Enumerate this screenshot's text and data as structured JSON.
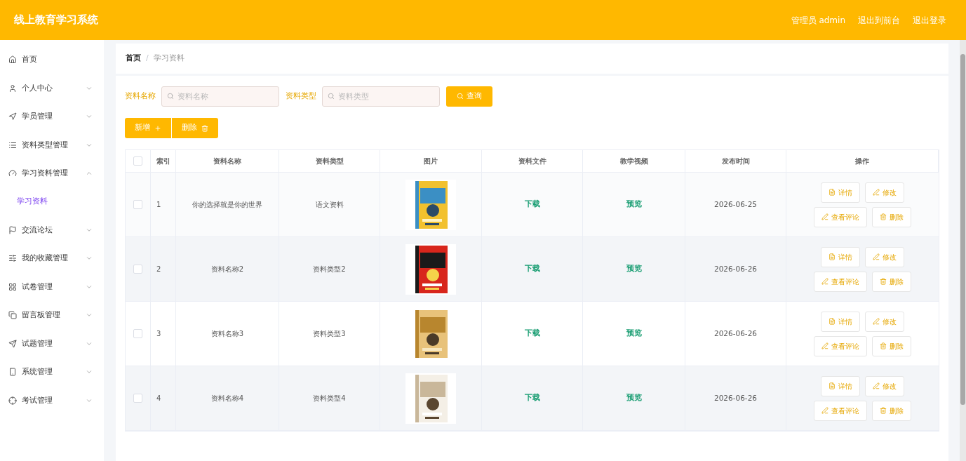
{
  "header": {
    "title": "线上教育学习系统",
    "links": [
      "管理员 admin",
      "退出到前台",
      "退出登录"
    ]
  },
  "sidebar": {
    "items": [
      {
        "label": "首页",
        "kind": "home"
      },
      {
        "label": "个人中心",
        "kind": "user",
        "expanded": false
      },
      {
        "label": "学员管理",
        "kind": "navigate",
        "expanded": false
      },
      {
        "label": "资料类型管理",
        "kind": "list",
        "expanded": false
      },
      {
        "label": "学习资料管理",
        "kind": "gauge",
        "expanded": true,
        "children": [
          {
            "label": "学习资料",
            "selected": true
          }
        ]
      },
      {
        "label": "交流论坛",
        "kind": "flag",
        "expanded": false
      },
      {
        "label": "我的收藏管理",
        "kind": "sliders",
        "expanded": false
      },
      {
        "label": "试卷管理",
        "kind": "grid",
        "expanded": false
      },
      {
        "label": "留言板管理",
        "kind": "copy",
        "expanded": false
      },
      {
        "label": "试题管理",
        "kind": "send",
        "expanded": false
      },
      {
        "label": "系统管理",
        "kind": "phone",
        "expanded": false
      },
      {
        "label": "考试管理",
        "kind": "target",
        "expanded": false
      }
    ]
  },
  "breadcrumb": {
    "separator": "/",
    "items": [
      "首页",
      "学习资料"
    ]
  },
  "search": {
    "fields": [
      {
        "label": "资料名称",
        "placeholder": "资料名称"
      },
      {
        "label": "资料类型",
        "placeholder": "资料类型"
      }
    ],
    "button": "查询"
  },
  "toolbar": [
    {
      "label": "新增",
      "kind": "add"
    },
    {
      "label": "删除",
      "kind": "delete"
    }
  ],
  "table": {
    "select_all": {
      "checked": false
    },
    "columns": [
      "索引",
      "资料名称",
      "资料类型",
      "图片",
      "资料文件",
      "教学视频",
      "发布时间",
      "操作"
    ],
    "rows": [
      {
        "checked": false,
        "index": "1",
        "name": "你的选择就是你的世界",
        "type": "语文资料",
        "file": "下载",
        "video": "预览",
        "date": "2026-06-25",
        "actions": [
          {
            "label": "详情",
            "kind": "detail"
          },
          {
            "label": "修改",
            "kind": "edit"
          },
          {
            "label": "查看评论",
            "kind": "comments"
          },
          {
            "label": "删除",
            "kind": "delete"
          }
        ]
      },
      {
        "checked": false,
        "index": "2",
        "name": "资料名称2",
        "type": "资料类型2",
        "file": "下载",
        "video": "预览",
        "date": "2026-06-26",
        "actions": [
          {
            "label": "详情",
            "kind": "detail"
          },
          {
            "label": "修改",
            "kind": "edit"
          },
          {
            "label": "查看评论",
            "kind": "comments"
          },
          {
            "label": "删除",
            "kind": "delete"
          }
        ]
      },
      {
        "checked": false,
        "index": "3",
        "name": "资料名称3",
        "type": "资料类型3",
        "file": "下载",
        "video": "预览",
        "date": "2026-06-26",
        "actions": [
          {
            "label": "详情",
            "kind": "detail"
          },
          {
            "label": "修改",
            "kind": "edit"
          },
          {
            "label": "查看评论",
            "kind": "comments"
          },
          {
            "label": "删除",
            "kind": "delete"
          }
        ]
      },
      {
        "checked": false,
        "index": "4",
        "name": "资料名称4",
        "type": "资料类型4",
        "file": "下载",
        "video": "预览",
        "date": "2026-06-26",
        "actions": [
          {
            "label": "详情",
            "kind": "detail"
          },
          {
            "label": "修改",
            "kind": "edit"
          },
          {
            "label": "查看评论",
            "kind": "comments"
          },
          {
            "label": "删除",
            "kind": "delete"
          }
        ]
      }
    ]
  }
}
